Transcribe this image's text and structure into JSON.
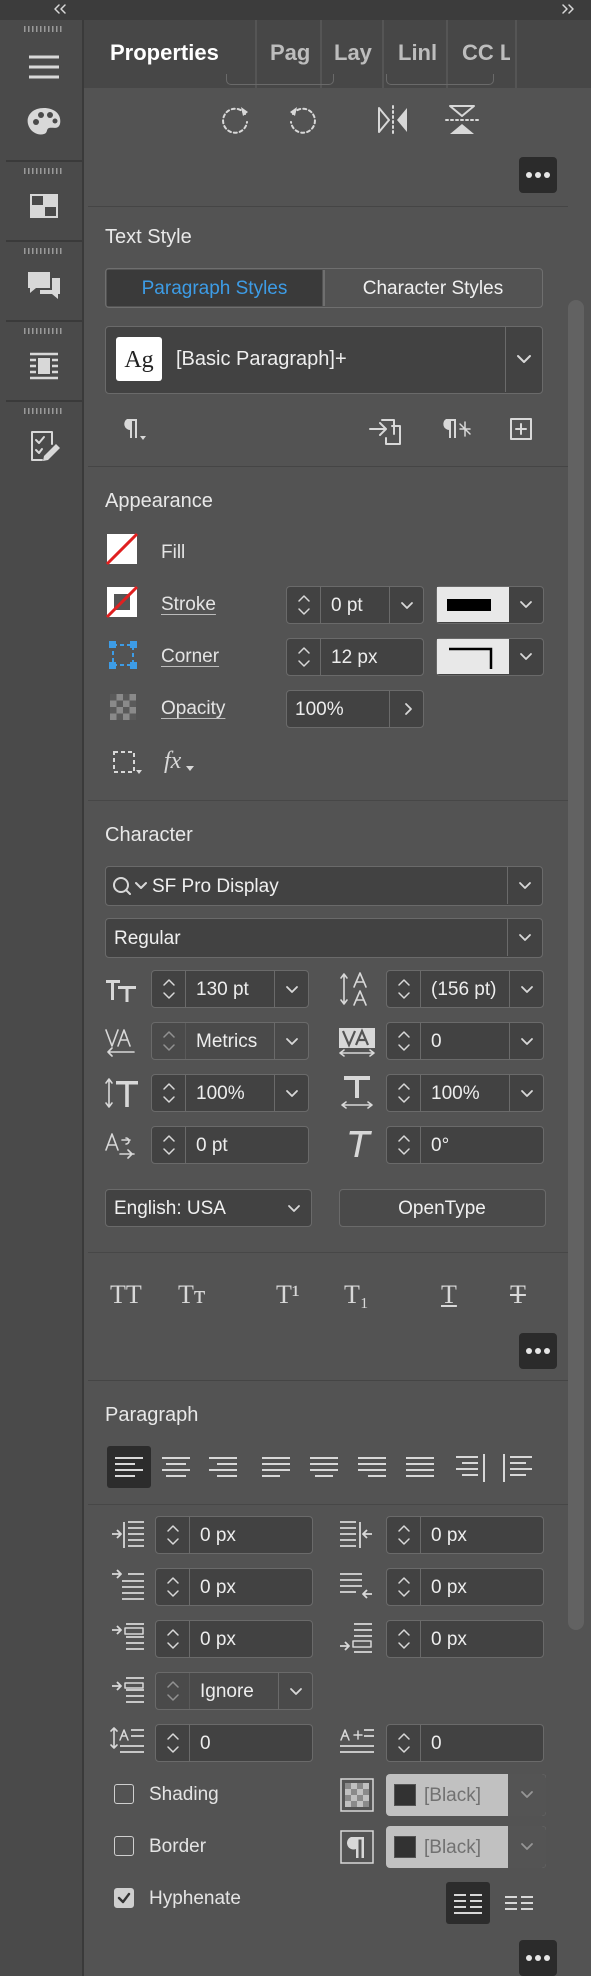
{
  "tabs": [
    {
      "label": "Properties"
    },
    {
      "label": "Pag"
    },
    {
      "label": "Lay"
    },
    {
      "label": "Linl"
    },
    {
      "label": "CC L"
    }
  ],
  "text_style": {
    "header": "Text Style",
    "paragraph_styles_tab": "Paragraph Styles",
    "character_styles_tab": "Character Styles",
    "style_icon_text": "Ag",
    "selected_style": "[Basic Paragraph]+"
  },
  "appearance": {
    "header": "Appearance",
    "fill_label": "Fill",
    "stroke_label": "Stroke",
    "stroke_value": "0 pt",
    "corner_label": "Corner",
    "corner_value": "12 px",
    "opacity_label": "Opacity",
    "opacity_value": "100%",
    "fx_label": "fx"
  },
  "character": {
    "header": "Character",
    "font_family": "SF Pro Display",
    "font_style": "Regular",
    "font_size": "130 pt",
    "leading": "(156 pt)",
    "kerning": "Metrics",
    "tracking": "0",
    "vertical_scale": "100%",
    "horizontal_scale": "100%",
    "baseline_shift": "0 pt",
    "skew": "0°",
    "language": "English: USA",
    "opentype_button": "OpenType",
    "type_styles": [
      "TT",
      "Tт",
      "T¹",
      "T₁",
      "T",
      "T"
    ]
  },
  "paragraph": {
    "header": "Paragraph",
    "left_indent": "0 px",
    "right_indent": "0 px",
    "first_line_indent": "0 px",
    "last_line_indent": "0 px",
    "space_before": "0 px",
    "space_after": "0 px",
    "align_to_grid": "Ignore",
    "drop_cap_lines": "0",
    "drop_cap_chars": "0",
    "shading_label": "Shading",
    "shading_color": "[Black]",
    "border_label": "Border",
    "border_color": "[Black]",
    "hyphenate_label": "Hyphenate",
    "hyphenate_checked": true,
    "shading_checked": false,
    "border_checked": false
  },
  "colors": {
    "accent": "#3d9ce6",
    "panel_bg": "#535353",
    "field_bg": "#424242"
  }
}
